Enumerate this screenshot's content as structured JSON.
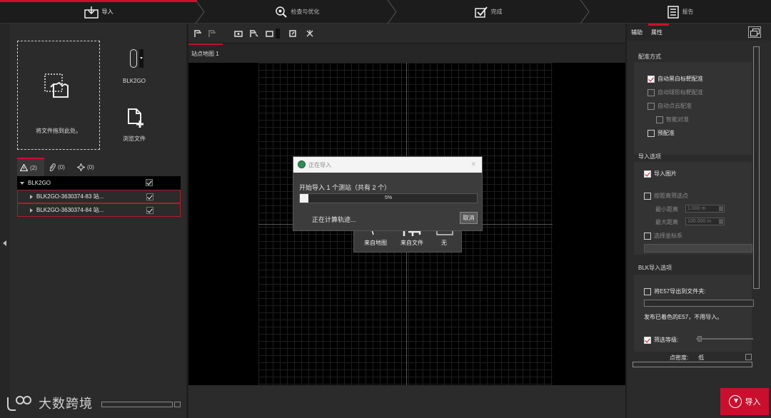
{
  "wizard": {
    "steps": [
      "导入",
      "检查与优化",
      "完成",
      "报告"
    ],
    "active_step": "导入"
  },
  "left": {
    "dropzone_label": "将文件拖到此处。",
    "device_name": "BLK2GO",
    "browse_label": "浏览文件",
    "tabs": [
      {
        "icon": "warning-icon",
        "count": "(2)"
      },
      {
        "icon": "paperclip-icon",
        "count": "(0)"
      },
      {
        "icon": "target-icon",
        "count": "(0)"
      }
    ],
    "tree": {
      "root": "BLK2GO",
      "items": [
        "BLK2GO-3630374-83  站...",
        "BLK2GO-3630374-84  站..."
      ]
    }
  },
  "watermark": "大数跨境",
  "center": {
    "map_tab": "站点地图 1",
    "origin_options": [
      "来自地图",
      "来自文件",
      "无"
    ]
  },
  "dialog": {
    "title": "正在导入",
    "message": "开始导入 1 个测站（共有 2 个）",
    "progress": 0.05,
    "progress_text": "5%",
    "status": "正在计算轨迹...",
    "cancel": "取消"
  },
  "right": {
    "tabs": [
      "辅助",
      "属性"
    ],
    "active_tab": "属性",
    "registration": {
      "title": "配准方式",
      "options": [
        {
          "label": "自动黑白标靶配准",
          "checked": true,
          "enabled": true
        },
        {
          "label": "自动球形标靶配准",
          "checked": false,
          "enabled": false
        },
        {
          "label": "自动点云配准",
          "checked": false,
          "enabled": false
        },
        {
          "label": "智能对准",
          "checked": false,
          "enabled": false
        },
        {
          "label": "预配准",
          "checked": false,
          "enabled": true
        }
      ]
    },
    "import_options": {
      "title": "导入选项",
      "import_images": "导入图片",
      "distance_filter": "按距离筛选点",
      "min_label": "最小距离",
      "min_value": "1.000 m",
      "max_label": "最大距离",
      "max_value": "100.000 m",
      "coord_system": "选择坐标系"
    },
    "blk": {
      "title": "BLK导入选项",
      "export_e57": "将E57导出到文件夹:",
      "publish_note": "发布已着色的E57，不用导入。",
      "filter_level": "筛选等级:",
      "density_label": "点密度:",
      "density_value": "低"
    }
  },
  "import_button": "导入",
  "colors": {
    "accent": "#c8102e",
    "bg": "#1e1e1e",
    "panel": "#2b2b2b"
  }
}
